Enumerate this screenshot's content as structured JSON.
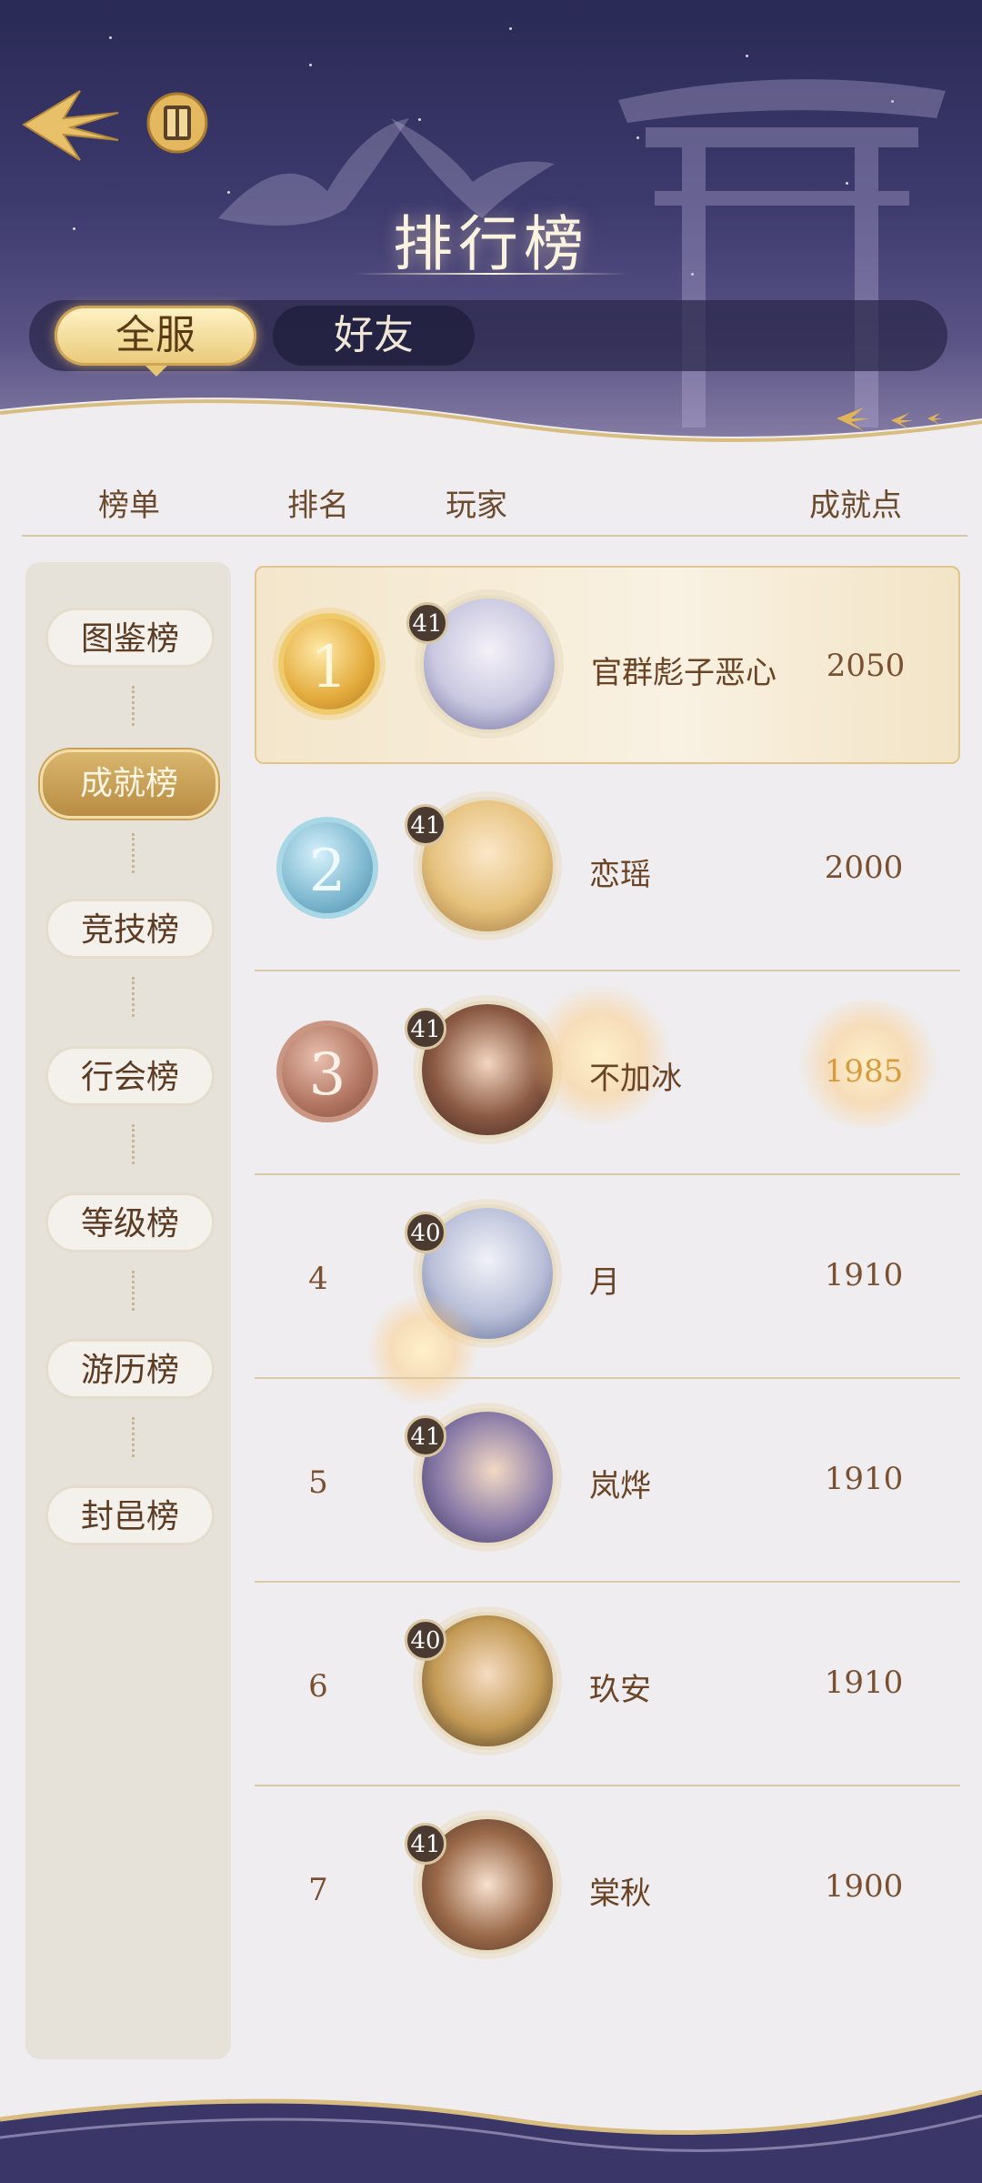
{
  "header": {
    "title": "排行榜",
    "tabs": [
      {
        "label": "全服",
        "selected": true
      },
      {
        "label": "好友",
        "selected": false
      }
    ]
  },
  "columns": {
    "list": "榜单",
    "rank": "排名",
    "player": "玩家",
    "score": "成就点"
  },
  "sidebar": {
    "items": [
      {
        "label": "图鉴榜",
        "active": false
      },
      {
        "label": "成就榜",
        "active": true
      },
      {
        "label": "竞技榜",
        "active": false
      },
      {
        "label": "行会榜",
        "active": false
      },
      {
        "label": "等级榜",
        "active": false
      },
      {
        "label": "游历榜",
        "active": false
      },
      {
        "label": "封邑榜",
        "active": false
      }
    ]
  },
  "rows": [
    {
      "rank": "1",
      "level": "41",
      "name": "官群彪子恶心",
      "score": "2050"
    },
    {
      "rank": "2",
      "level": "41",
      "name": "恋瑶",
      "score": "2000"
    },
    {
      "rank": "3",
      "level": "41",
      "name": "不加冰",
      "score": "1985"
    },
    {
      "rank": "4",
      "level": "40",
      "name": "月",
      "score": "1910"
    },
    {
      "rank": "5",
      "level": "41",
      "name": "岚烨",
      "score": "1910"
    },
    {
      "rank": "6",
      "level": "40",
      "name": "玖安",
      "score": "1910"
    },
    {
      "rank": "7",
      "level": "41",
      "name": "棠秋",
      "score": "1900"
    }
  ],
  "colors": {
    "gold": "#e3ab3c",
    "silver": "#7db7cf",
    "bronze": "#b07460",
    "text_brown": "#6b4426",
    "header_dark": "#2a2a55"
  },
  "icons": [
    "back-arrow-icon",
    "scroll-icon",
    "gold-medal-icon",
    "silver-medal-icon",
    "bronze-medal-icon"
  ]
}
